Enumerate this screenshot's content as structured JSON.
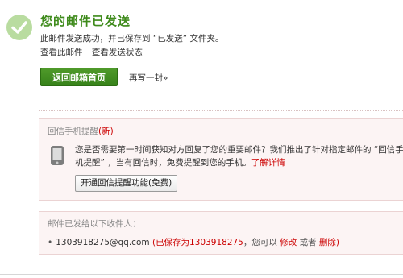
{
  "status": {
    "title": "您的邮件已发送",
    "subtitle": "此邮件发送成功，并已保存到 “已发送” 文件夹。",
    "view_mail_link": "查看此邮件",
    "view_status_link": "查看发送状态"
  },
  "actions": {
    "home_button": "返回邮箱首页",
    "write_another": "再写一封»"
  },
  "reminder": {
    "heading": "回信手机提醒",
    "new_badge": "(新)",
    "description": "您是否需要第一时间获知对方回复了您的重要邮件？我们推出了针对指定邮件的 “回信手机提醒” ，当有回信时，免费提醒到您的手机。",
    "learn_more": "了解详情",
    "enable_button": "开通回信提醒功能(免费)"
  },
  "recipients": {
    "heading": "邮件已发给以下收件人：",
    "items": [
      {
        "email": "1303918275@qq.com",
        "saved_label": "已保存为1303918275",
        "note": "，您可以",
        "edit_label": "修改",
        "or_label": "或者",
        "delete_label": "删除"
      }
    ]
  },
  "colors": {
    "success_green": "#3f8b1c",
    "button_green": "#37821a",
    "alert_red": "#cc0000",
    "box_bg": "#fcf4f4"
  }
}
